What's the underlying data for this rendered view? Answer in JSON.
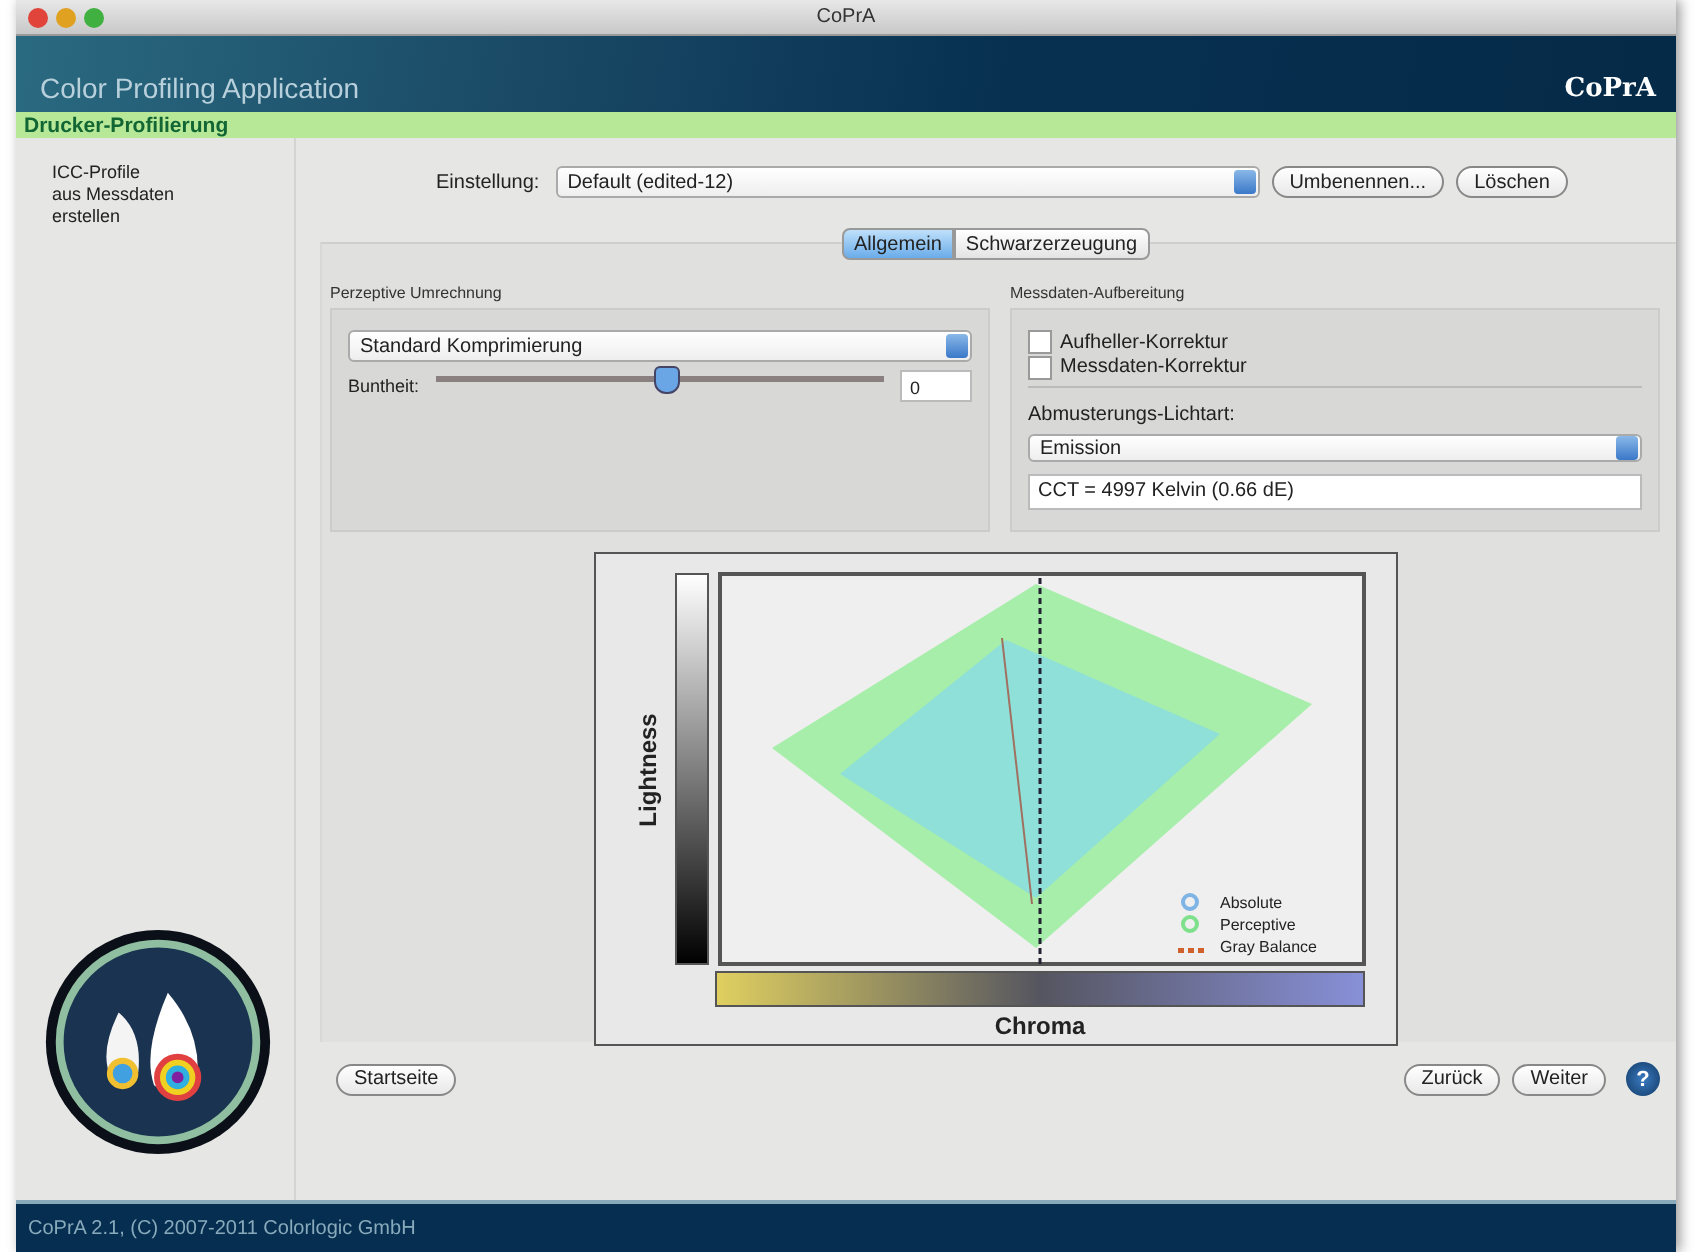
{
  "window": {
    "title": "CoPrA"
  },
  "header": {
    "title": "Color Profiling Application",
    "logo": "CoPrA"
  },
  "section": "Drucker-Profilierung",
  "sidebar": {
    "lines": [
      "ICC-Profile",
      "aus Messdaten",
      "erstellen"
    ]
  },
  "setting": {
    "label": "Einstellung:",
    "value": "Default (edited-12)",
    "buttons": [
      "Umbenennen...",
      "Löschen"
    ]
  },
  "tabs": [
    {
      "label": "Allgemein",
      "selected": true
    },
    {
      "label": "Schwarzerzeugung",
      "selected": false
    }
  ],
  "perceptual": {
    "title": "Perzeptive Umrechnung",
    "dropdown": "Standard Komprimierung",
    "slider": {
      "label": "Buntheit:",
      "level": 0.51,
      "value": "0"
    }
  },
  "measurement": {
    "title": "Messdaten-Aufbereitung",
    "checkboxes": [
      {
        "label": "Aufheller-Korrektur",
        "checked": false
      },
      {
        "label": "Messdaten-Korrektur",
        "checked": false
      }
    ],
    "illuminant_label": "Abmusterungs-Lichtart:",
    "illuminant": "Emission",
    "cct": "CCT = 4997 Kelvin (0.66 dE)"
  },
  "chart": {
    "ylabel": "Lightness",
    "xlabel": "Chroma",
    "legend": [
      {
        "label": "Absolute",
        "kind": "circle",
        "color": "#7fb4e6"
      },
      {
        "label": "Perceptive",
        "kind": "circle",
        "color": "#7ee08a"
      },
      {
        "label": "Gray Balance",
        "kind": "dashes",
        "color": "#d0602c"
      }
    ]
  },
  "nav": {
    "home": "Startseite",
    "back": "Zurück",
    "next": "Weiter",
    "help": "?"
  },
  "footer": "CoPrA 2.1, (C) 2007-2011 Colorlogic GmbH"
}
